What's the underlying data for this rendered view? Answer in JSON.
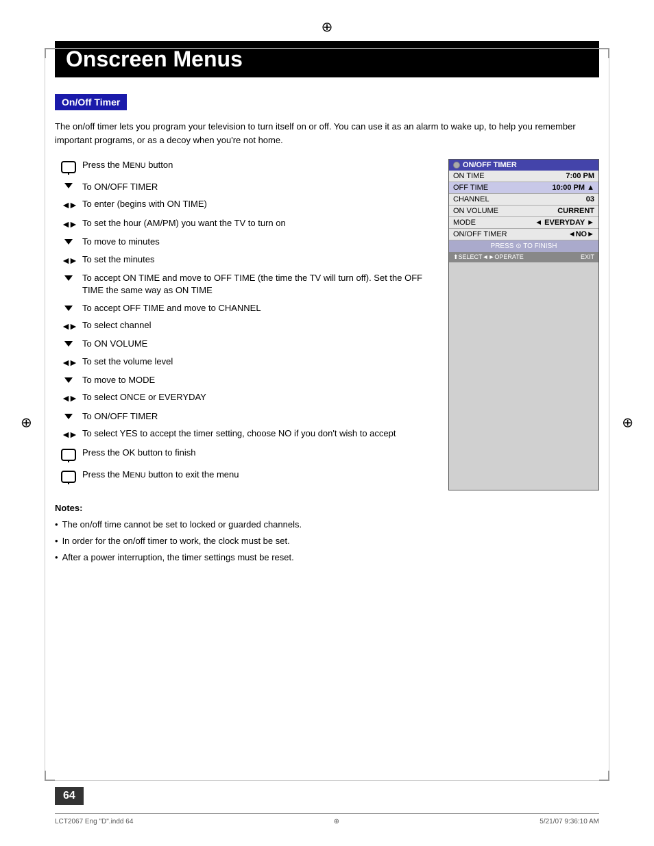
{
  "page": {
    "number": "64",
    "title": "Onscreen Menus",
    "footer_left": "LCT2067 Eng \"D\".indd   64",
    "footer_right": "5/21/07   9:36:10 AM"
  },
  "section": {
    "title": "On/Off Timer",
    "intro": "The on/off timer lets you program your television to turn itself on or off. You can use it as an alarm to wake up, to help you remember important programs, or as a decoy when you're not home."
  },
  "steps": [
    {
      "icon": "menu-button-icon",
      "text": "Press the MENU button"
    },
    {
      "icon": "arrow-down-icon",
      "text": "To ON/OFF TIMER"
    },
    {
      "icon": "arrow-lr-icon",
      "text": "To enter (begins with ON TIME)"
    },
    {
      "icon": "arrow-lr-icon",
      "text": "To set the hour (AM/PM) you want the TV to turn on"
    },
    {
      "icon": "arrow-down-icon",
      "text": "To move to minutes"
    },
    {
      "icon": "arrow-lr-icon",
      "text": "To set the minutes"
    },
    {
      "icon": "arrow-down-icon",
      "text": "To accept ON TIME and move to OFF TIME (the time the TV will turn off). Set the OFF TIME the same way as ON TIME"
    },
    {
      "icon": "arrow-down-icon",
      "text": "To accept OFF TIME and move to CHANNEL"
    },
    {
      "icon": "arrow-lr-icon",
      "text": "To select channel"
    },
    {
      "icon": "arrow-down-icon",
      "text": "To ON VOLUME"
    },
    {
      "icon": "arrow-lr-icon",
      "text": "To set the volume level"
    },
    {
      "icon": "arrow-down-icon",
      "text": "To move to MODE"
    },
    {
      "icon": "arrow-lr-icon",
      "text": "To select ONCE or EVERYDAY"
    },
    {
      "icon": "arrow-down-icon",
      "text": "To ON/OFF TIMER"
    },
    {
      "icon": "arrow-lr-icon",
      "text": "To select YES to accept the timer setting, choose NO if you don't wish to accept"
    },
    {
      "icon": "menu-button-icon",
      "text": "Press the OK button to finish"
    },
    {
      "icon": "menu-button-icon",
      "text": "Press the MENU button to exit the menu"
    }
  ],
  "timer_screen": {
    "title": "ON/OFF TIMER",
    "rows": [
      {
        "label": "ON TIME",
        "value": "7:00 PM",
        "highlighted": false
      },
      {
        "label": "OFF TIME",
        "value": "10:00 PM",
        "highlighted": true
      },
      {
        "label": "CHANNEL",
        "value": "03",
        "highlighted": false
      },
      {
        "label": "ON VOLUME",
        "value": "CURRENT",
        "highlighted": false
      },
      {
        "label": "MODE",
        "value": "◄ EVERYDAY ►",
        "highlighted": false
      },
      {
        "label": "ON/OFF TIMER",
        "value": "◄NO►",
        "highlighted": false
      }
    ],
    "footer": "PRESS ⊙ TO FINISH",
    "nav": "⬆SELECT◄►OPERATE       EXIT"
  },
  "notes": {
    "title": "Notes:",
    "items": [
      "The on/off time cannot be set to locked or guarded channels.",
      "In order for the on/off timer to work, the clock must be set.",
      "After a power interruption, the timer settings must be reset."
    ]
  }
}
